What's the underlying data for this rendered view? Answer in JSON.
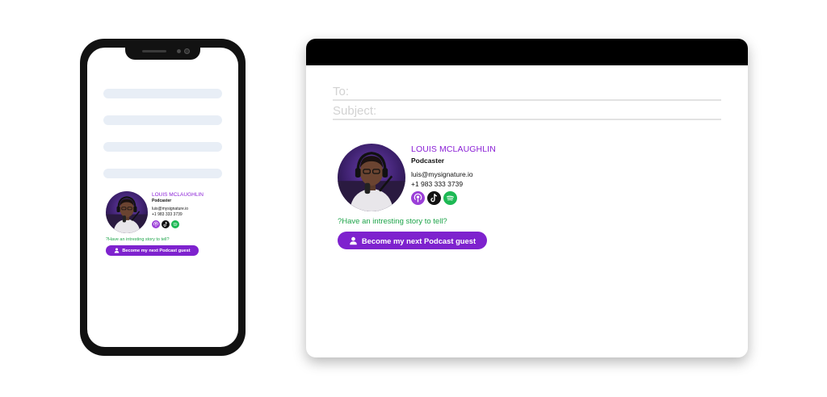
{
  "email": {
    "to_label": "To:",
    "subject_label": "Subject:"
  },
  "signature": {
    "name": "LOUIS MCLAUGHLIN",
    "title": "Podcaster",
    "email": "luis@mysignature.io",
    "phone": "+1 983 333 3739",
    "socials": [
      {
        "icon": "podcast-icon",
        "color": "#9b3fd8"
      },
      {
        "icon": "tiktok-icon",
        "color": "#111111"
      },
      {
        "icon": "spotify-icon",
        "color": "#1db954"
      }
    ],
    "cta_text": "?Have an intresting story to tell?",
    "button_label": "Become my next Podcast guest",
    "accent_color": "#7e22ce",
    "name_color": "#8a1fd6",
    "cta_color": "#1ea44a"
  }
}
